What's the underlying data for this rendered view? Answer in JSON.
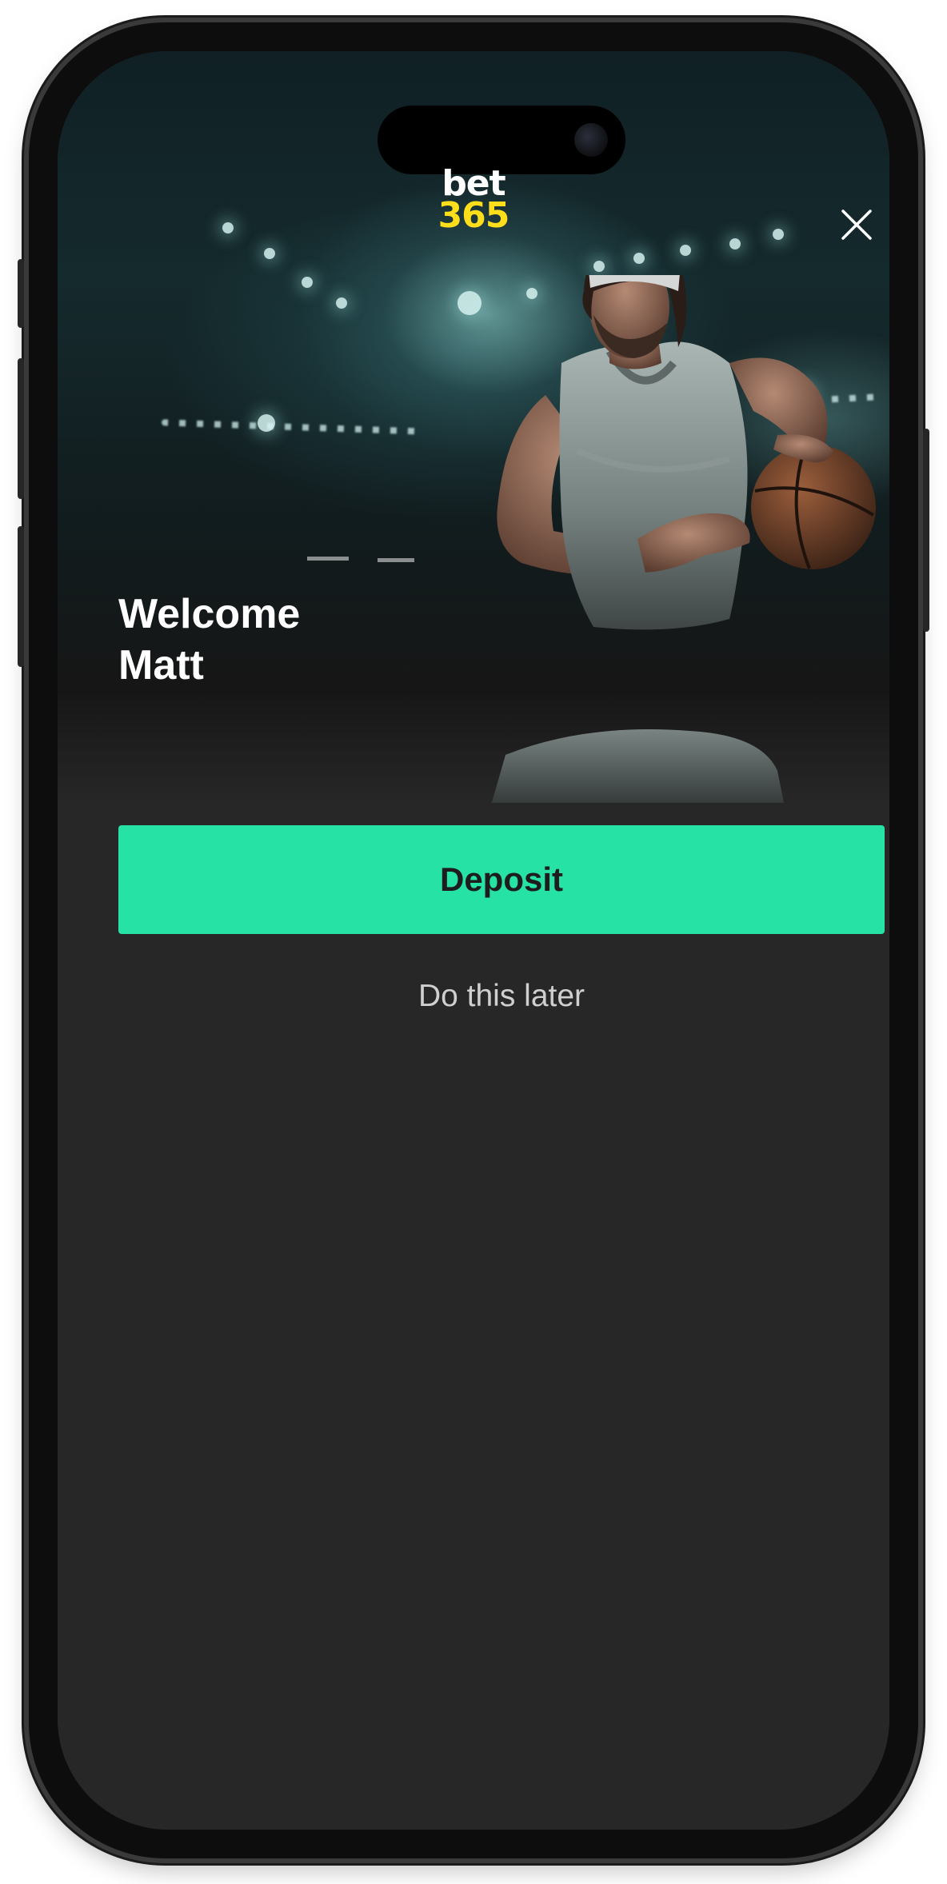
{
  "header": {
    "logo_top": "bet",
    "logo_bottom": "365",
    "close_icon": "close-icon"
  },
  "hero": {
    "welcome_line1": "Welcome",
    "welcome_line2": "Matt"
  },
  "actions": {
    "deposit_label": "Deposit",
    "later_label": "Do this later"
  },
  "colors": {
    "accent": "#26e2a5",
    "logo_yellow": "#ffdf1b",
    "background": "#272727"
  }
}
